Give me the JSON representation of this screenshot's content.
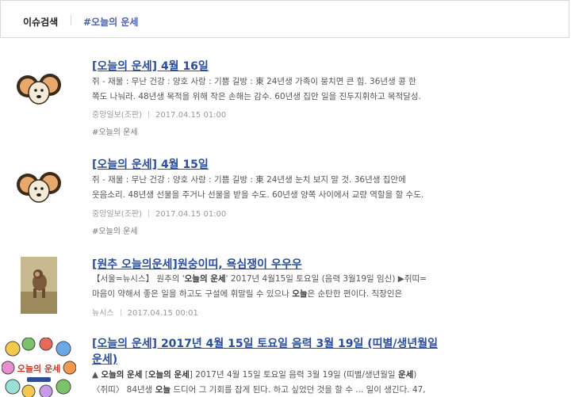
{
  "issue_bar": {
    "label": "이슈검색",
    "tag": "#오늘의 운세"
  },
  "articles": [
    {
      "title": "[오늘의 운세] 4월 16일",
      "summary_line1": "쥐 - 재물 : 무난 건강 : 양호 사랑 : 기쁨 길방 : 東 24년생 가족이 뭉치면 큰 힘. 36년생 콩 한",
      "summary_line2": "쪽도 나눠라. 48년생 목적을 위해 작은 손해는 감수. 60년생 집안 일을 진두지휘하고 목적달성.",
      "source": "중앙일보(조판)",
      "date": "2017.04.15 01:00",
      "hashtag": "#오늘의 운세",
      "thumb_icon": "mouse-cartoon-icon"
    },
    {
      "title": "[오늘의 운세] 4월 15일",
      "summary_line1": "쥐 - 재물 : 무난 건강 : 양호 사랑 : 기쁨 길방 : 東 24년생 눈치 보지 말 것. 36년생 집안에",
      "summary_line2": "웃음소리. 48년생 선물을 주거나 선물을 받을 수도. 60년생 양쪽 사이에서 교량 역할을 할 수도.",
      "source": "중앙일보(조판)",
      "date": "2017.04.15 01:00",
      "hashtag": "#오늘의 운세",
      "thumb_icon": "mouse-cartoon-icon"
    },
    {
      "title": "[원추 오늘의운세]원숭이띠, 욕심쟁이 우우우",
      "summary_prefix": "【서울=뉴시스】 원추의 '",
      "summary_hl": "오늘의 운세",
      "summary_suffix": "' 2017년 4월15일 토요일 (음력 3월19일 임신) ▶쥐띠=",
      "summary_line2_pre": "마음이 약해서 좋은 일을 하고도 구설에 휘말릴 수 있으나 ",
      "summary_line2_hl": "오늘",
      "summary_line2_post": "은 순탄한 편이다. 직장인은",
      "source": "뉴시스",
      "date": "2017.04.15 00:01",
      "thumb_icon": "monkey-photo-icon"
    },
    {
      "title": "[오늘의 운세] 2017년 4월 15일 토요일 음력 3월 19일 (띠별/생년월일",
      "title_line2": "운세)",
      "summary_line1_a": "▲ ",
      "summary_line1_hl1": "오늘의 운세",
      "summary_line1_b": " [",
      "summary_line1_hl2": "오늘의 운세",
      "summary_line1_c": "] 2017년 4월 15일 토요일 음력 3월 19일 (띠별/생년월일 ",
      "summary_line1_hl3": "운세",
      "summary_line1_d": ")",
      "summary_line2_pre": "〈쥐띠〉 84년생 ",
      "summary_line2_hl": "오늘",
      "summary_line2_post": " 드디어 그 기회를 잡게 된다. 하고 싶었던 것을 할 수 ... 일이 생긴다. 47,",
      "thumb_label": "오늘의 운세",
      "thumb_icon": "zodiac-wheel-icon"
    }
  ]
}
